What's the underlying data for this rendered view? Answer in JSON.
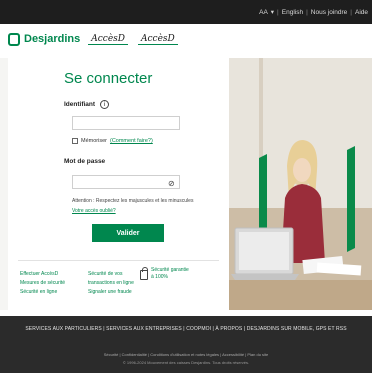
{
  "topbar": {
    "links": [
      "AA",
      "English",
      "Nous joindre",
      "Aide"
    ],
    "aa_icon": "chevron-down-icon"
  },
  "header": {
    "brand_name": "Desjardins",
    "brand_icon": "desjardins-hexagon-icon",
    "logos": [
      "AccèsD",
      "AccèsD"
    ]
  },
  "login": {
    "title": "Se connecter",
    "identifier_label": "Identifiant",
    "identifier_value": "",
    "remember_label": "Mémoriser",
    "remember_link": "(Comment faire?)",
    "password_label": "Mot de passe",
    "password_value": "",
    "hint_text": "Attention : Respectez les majuscules et les minuscules",
    "forgot_link": "Votre accès oublié?",
    "submit_label": "Valider"
  },
  "footer_links": {
    "col1": [
      "Effectuer AccèsD",
      "Mesures de sécurité",
      "Sécurité en ligne"
    ],
    "col2": [
      "Sécurité de vos",
      "transactions en ligne",
      "Signaler une fraude"
    ],
    "security_text": "Sécurité garantie à 100%"
  },
  "footer": {
    "nav": "SERVICES AUX PARTICULIERS | SERVICES AUX ENTREPRISES | COOPMOI | À PROPOS | DESJARDINS SUR MOBILE, GPS ET RSS",
    "legal": "Sécurité | Confidentialité | Conditions d'utilisation et notes légales | Accessibilité | Plan du site",
    "copyright": "© 1996-2024 Mouvement des caisses Desjardins. Tous droits réservés."
  },
  "colors": {
    "brand_green": "#00874e",
    "topbar_bg": "#1e1e1e",
    "footer_bg": "#2b2b2b"
  }
}
